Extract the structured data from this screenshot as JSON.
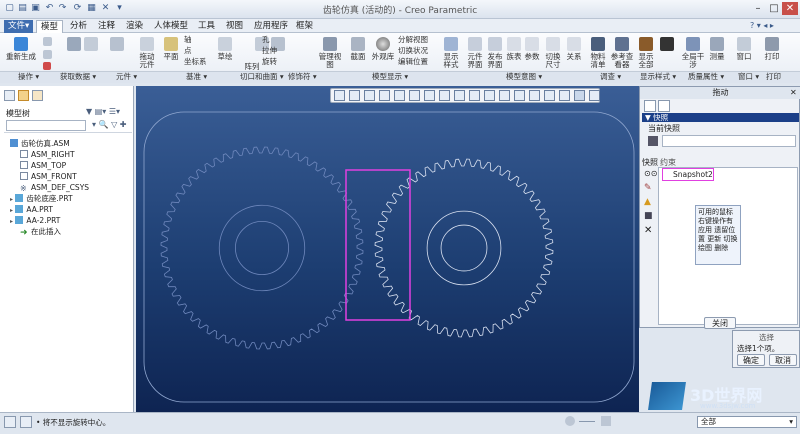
{
  "window": {
    "title": "齿轮仿真 (活动的) - Creo Parametric"
  },
  "menu_tabs": [
    "文件▾",
    "模型",
    "分析",
    "注释",
    "渲染",
    "人体模型",
    "工具",
    "视图",
    "应用程序",
    "框架"
  ],
  "active_tab": "模型",
  "ribbon": {
    "items": [
      "重新生成",
      "复制",
      "粘贴",
      "删除",
      "拖动元件",
      "平面",
      "轴",
      "点",
      "坐标系",
      "草绘",
      "阵列",
      "孔",
      "拉伸",
      "旋转",
      "管理视图",
      "截面",
      "外观库",
      "分解视图",
      "切换状况",
      "编辑位置",
      "显示样式",
      "元件界面",
      "发布界面",
      "族表",
      "参数",
      "切换尺寸",
      "关系",
      "物料清单",
      "参考查看器",
      "显示全部",
      "全局干涉",
      "测量",
      "窗口",
      "打印"
    ],
    "groups": [
      "操作 ▾",
      "获取数据 ▾",
      "元件 ▾",
      "基准 ▾",
      "切口和曲面 ▾",
      "修饰符 ▾",
      "模型显示 ▾",
      "模型意图 ▾",
      "调查 ▾",
      "显示样式 ▾",
      "质量属性 ▾",
      "窗口 ▾",
      "打印"
    ]
  },
  "model_tree": {
    "title": "模型树",
    "items": [
      "齿轮仿真.ASM",
      "ASM_RIGHT",
      "ASM_TOP",
      "ASM_FRONT",
      "ASM_DEF_CSYS",
      "齿轮底座.PRT",
      "AA.PRT",
      "AA-2.PRT",
      "在此插入"
    ]
  },
  "drag_dialog": {
    "title": "拖动",
    "section": "快照",
    "current_label": "当前快照",
    "snapshot_tab": "快照",
    "constraint_tab": "约束",
    "snapshot_name": "Snapshot2",
    "tooltip": "可用的鼠标右键操作有 应用 遗留位置 更新 切换绘图 删除",
    "close_button": "关闭"
  },
  "select_panel": {
    "title": "选择",
    "message": "选择1个项。",
    "ok": "确定",
    "cancel": "取消"
  },
  "status": {
    "message": "• 将不显示旋转中心。",
    "filter": "全部"
  },
  "watermark": {
    "text": "3D世界网",
    "url": "www.3dsjw.com"
  },
  "colors": {
    "viewport_top": "#3a5e96",
    "viewport_bottom": "#0e2452",
    "highlight": "#e040e0",
    "accent": "#1b3f88"
  }
}
